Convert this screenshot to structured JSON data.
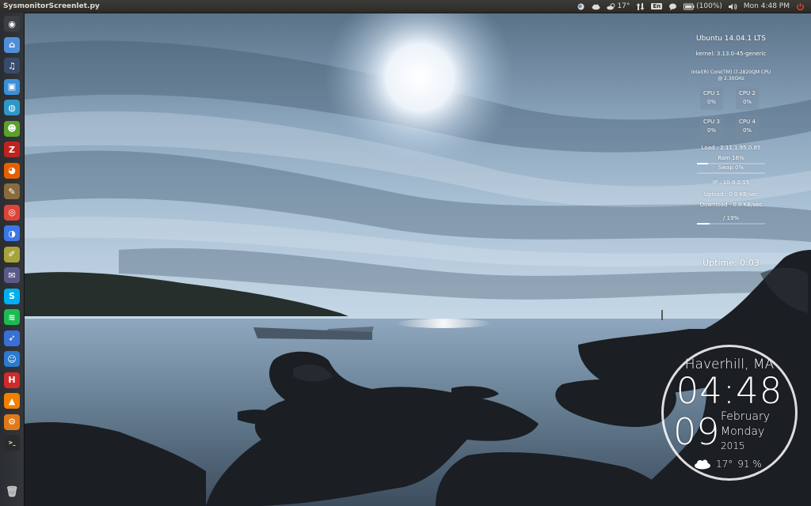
{
  "top_panel": {
    "app_title": "SysmonitorScreenlet.py",
    "temperature": "17°",
    "keyboard_layout": "En",
    "battery": "(100%)",
    "clock": "Mon 4:48 PM"
  },
  "launcher": {
    "items": [
      {
        "name": "dash-home",
        "icon": "ubuntu-logo",
        "color": "#3b3e42"
      },
      {
        "name": "files",
        "icon": "home-folder-icon",
        "color": "#4f8fd8"
      },
      {
        "name": "audio-player",
        "icon": "headphones-icon",
        "color": "#3a4a6a"
      },
      {
        "name": "app-blue",
        "icon": "blue-square-icon",
        "color": "#3a8fd8"
      },
      {
        "name": "browser-globe",
        "icon": "globe-icon",
        "color": "#2f96c8"
      },
      {
        "name": "android",
        "icon": "android-icon",
        "color": "#5ca02c"
      },
      {
        "name": "filezilla",
        "icon": "filezilla-icon",
        "color": "#c0231e"
      },
      {
        "name": "firefox",
        "icon": "firefox-icon",
        "color": "#e66000"
      },
      {
        "name": "gimp",
        "icon": "gimp-icon",
        "color": "#8a6b3d"
      },
      {
        "name": "chrome",
        "icon": "chrome-icon",
        "color": "#db4437"
      },
      {
        "name": "chromium",
        "icon": "chromium-icon",
        "color": "#3b78e7"
      },
      {
        "name": "notes",
        "icon": "notes-icon",
        "color": "#a8a23a"
      },
      {
        "name": "pidgin",
        "icon": "pidgin-icon",
        "color": "#5a5a8a"
      },
      {
        "name": "skype",
        "icon": "skype-icon",
        "color": "#00aff0"
      },
      {
        "name": "spotify",
        "icon": "spotify-icon",
        "color": "#1db954"
      },
      {
        "name": "app-wing",
        "icon": "wing-icon",
        "color": "#3a6fd8"
      },
      {
        "name": "tux",
        "icon": "tux-icon",
        "color": "#2a7ad0"
      },
      {
        "name": "app-red",
        "icon": "red-circle-icon",
        "color": "#d02a2a"
      },
      {
        "name": "vlc",
        "icon": "vlc-cone-icon",
        "color": "#f08000"
      },
      {
        "name": "system-settings",
        "icon": "gear-icon",
        "color": "#e07a18"
      },
      {
        "name": "terminal",
        "icon": "terminal-icon",
        "color": "#2b2b2b"
      },
      {
        "name": "trash",
        "icon": "trash-icon",
        "color": "#9a9a9a"
      }
    ]
  },
  "sysmonitor": {
    "os": "Ubuntu 14.04.1 LTS",
    "kernel": "kernel: 3.13.0-45-generic",
    "cpu_model_line1": "Intel(R) Core(TM) i7-2820QM CPU",
    "cpu_model_line2": "@ 2.30GHz",
    "cpus": [
      {
        "label": "CPU 1",
        "value": "0%"
      },
      {
        "label": "CPU 2",
        "value": "0%"
      },
      {
        "label": "CPU 3",
        "value": "0%"
      },
      {
        "label": "CPU 4",
        "value": "0%"
      }
    ],
    "load": "Load : 2.11,1.95,0.85",
    "ram": "Ram 16%",
    "ram_fraction": 0.16,
    "swap": "Swap 0%",
    "swap_fraction": 0.0,
    "ip": "IP : 10.0.2.15",
    "upload": "Upload : 0.0 KB/sec",
    "download": "Download : 0.0 KB/sec",
    "disk": "/ 19%",
    "disk_fraction": 0.19,
    "uptime": "Uptime: 0:03"
  },
  "clock_widget": {
    "city": "Haverhill, MA",
    "time": "04:48",
    "day": "09",
    "month": "February",
    "weekday": "Monday",
    "year": "2015",
    "temperature": "17°",
    "humidity": "91 %"
  }
}
